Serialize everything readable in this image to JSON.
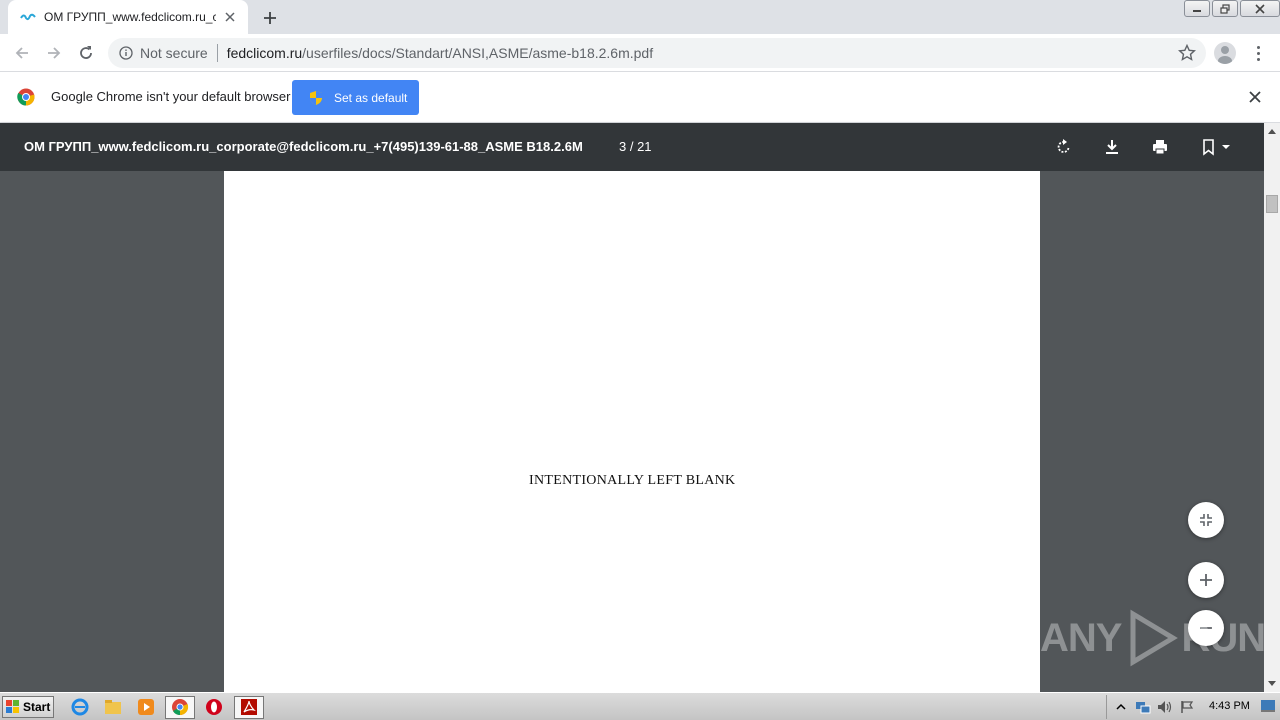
{
  "tab": {
    "title": "ОМ ГРУПП_www.fedclicom.ru_corpo",
    "favicon": "fedclicom-favicon"
  },
  "window_controls": [
    "minimize-icon",
    "restore-icon",
    "close-icon"
  ],
  "toolbar": {
    "not_secure": "Not secure",
    "url_host": "fedclicom.ru",
    "url_path": "/userfiles/docs/Standart/ANSI,ASME/asme-b18.2.6m.pdf"
  },
  "infobar": {
    "message": "Google Chrome isn't your default browser",
    "button_label": "Set as default"
  },
  "pdf": {
    "title": "ОМ ГРУПП_www.fedclicom.ru_corporate@fedclicom.ru_+7(495)139-61-88_ASME B18.2.6M",
    "page_indicator": "3 / 21",
    "page_text": "INTENTIONALLY LEFT BLANK"
  },
  "watermark": {
    "left": "ANY",
    "right": "RUN"
  },
  "taskbar": {
    "start_label": "Start",
    "clock": "4:43 PM"
  },
  "colors": {
    "pdf_toolbar": "#323639",
    "pdf_background": "#525659",
    "accent": "#4285f4"
  }
}
